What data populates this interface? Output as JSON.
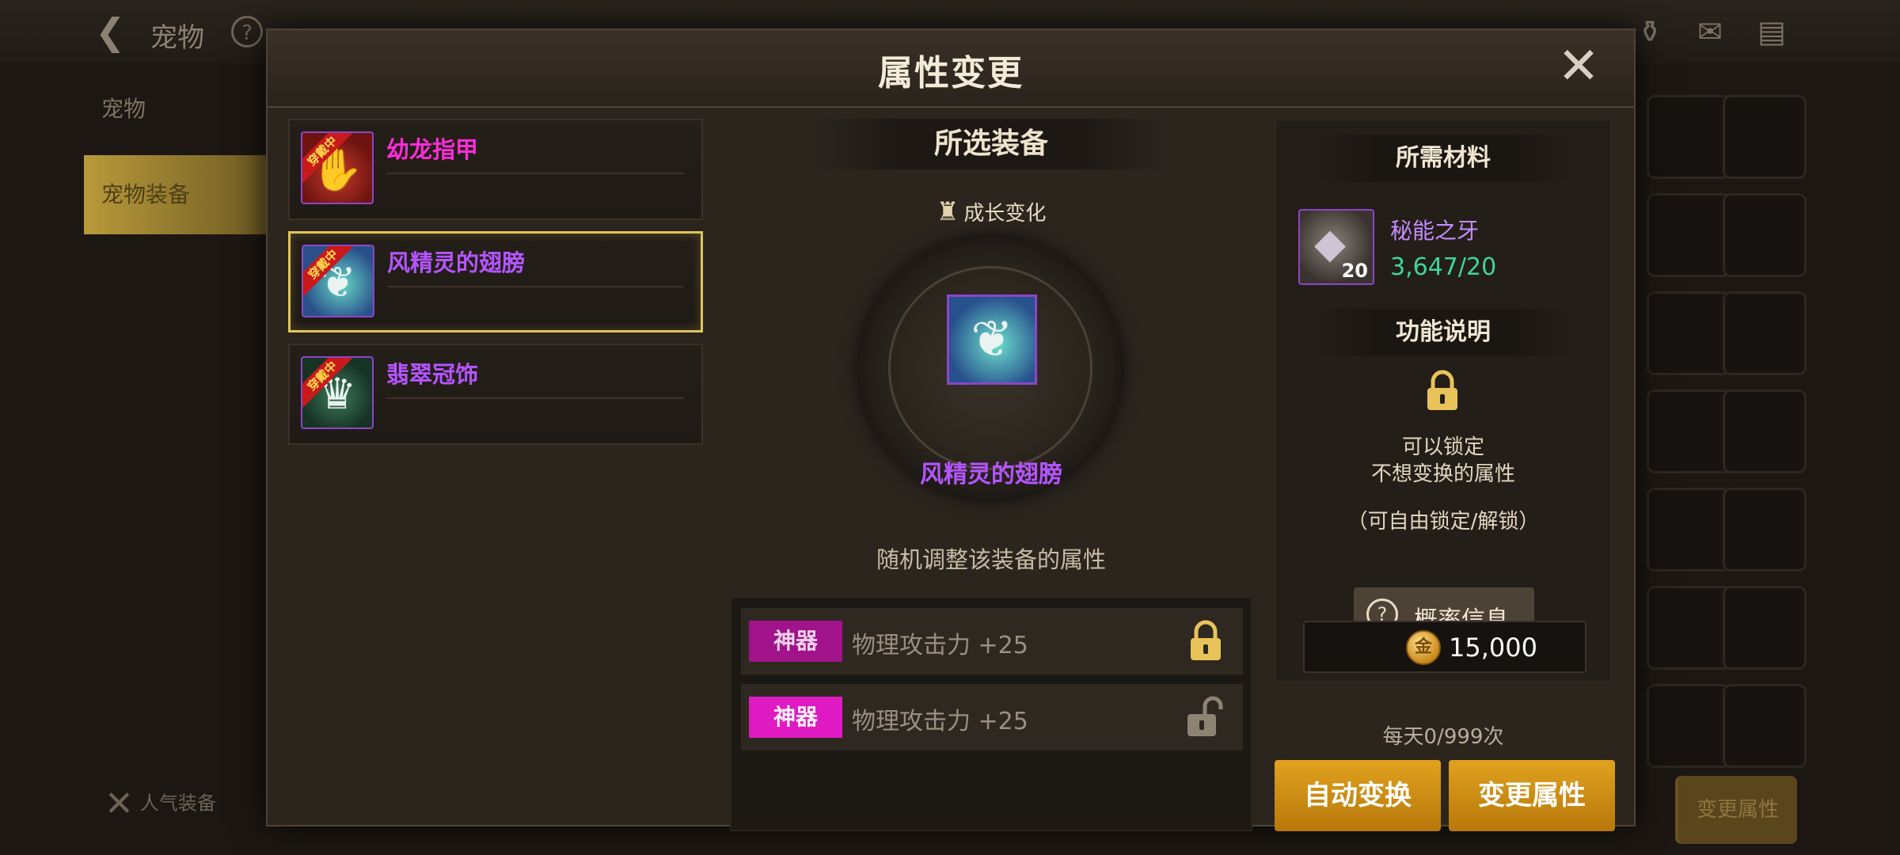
{
  "background": {
    "title": "宠物",
    "sidebar": [
      "宠物",
      "宠物装备"
    ],
    "popular_label": "人气装备",
    "bottom_buttons": [
      "",
      "变更属性"
    ]
  },
  "dialog": {
    "title": "属性变更",
    "equipment_list": [
      {
        "name": "幼龙指甲",
        "badge": "穿戴中",
        "selected": false,
        "name_color": "#ff2cda"
      },
      {
        "name": "风精灵的翅膀",
        "badge": "穿戴中",
        "selected": true,
        "name_color": "#b455ff"
      },
      {
        "name": "翡翠冠饰",
        "badge": "穿戴中",
        "selected": false,
        "name_color": "#b455ff"
      }
    ],
    "center": {
      "section_title": "所选装备",
      "growth_label": "成长变化",
      "selected_name": "风精灵的翅膀",
      "description": "随机调整该装备的属性",
      "attributes": [
        {
          "tag": "神器",
          "text": "物理攻击力 +25",
          "locked": true
        },
        {
          "tag": "神器",
          "text": "物理攻击力 +25",
          "locked": false
        }
      ]
    },
    "right": {
      "materials_title": "所需材料",
      "material_name": "秘能之牙",
      "material_count": "20",
      "material_owned": "3,647/20",
      "function_title": "功能说明",
      "function_line1": "可以锁定",
      "function_line2": "不想变换的属性",
      "function_note": "（可自由锁定/解锁）",
      "probability_label": "概率信息",
      "gold_cost": "15,000",
      "daily_limit": "每天0/999次",
      "auto_button": "自动变换",
      "change_button": "变更属性"
    }
  },
  "colors": {
    "accent_gold": "#e0a21e",
    "epic_purple": "#b455ff",
    "magenta": "#ff2cda",
    "success_green": "#3ed69a",
    "selected_border": "#e0c45a"
  }
}
